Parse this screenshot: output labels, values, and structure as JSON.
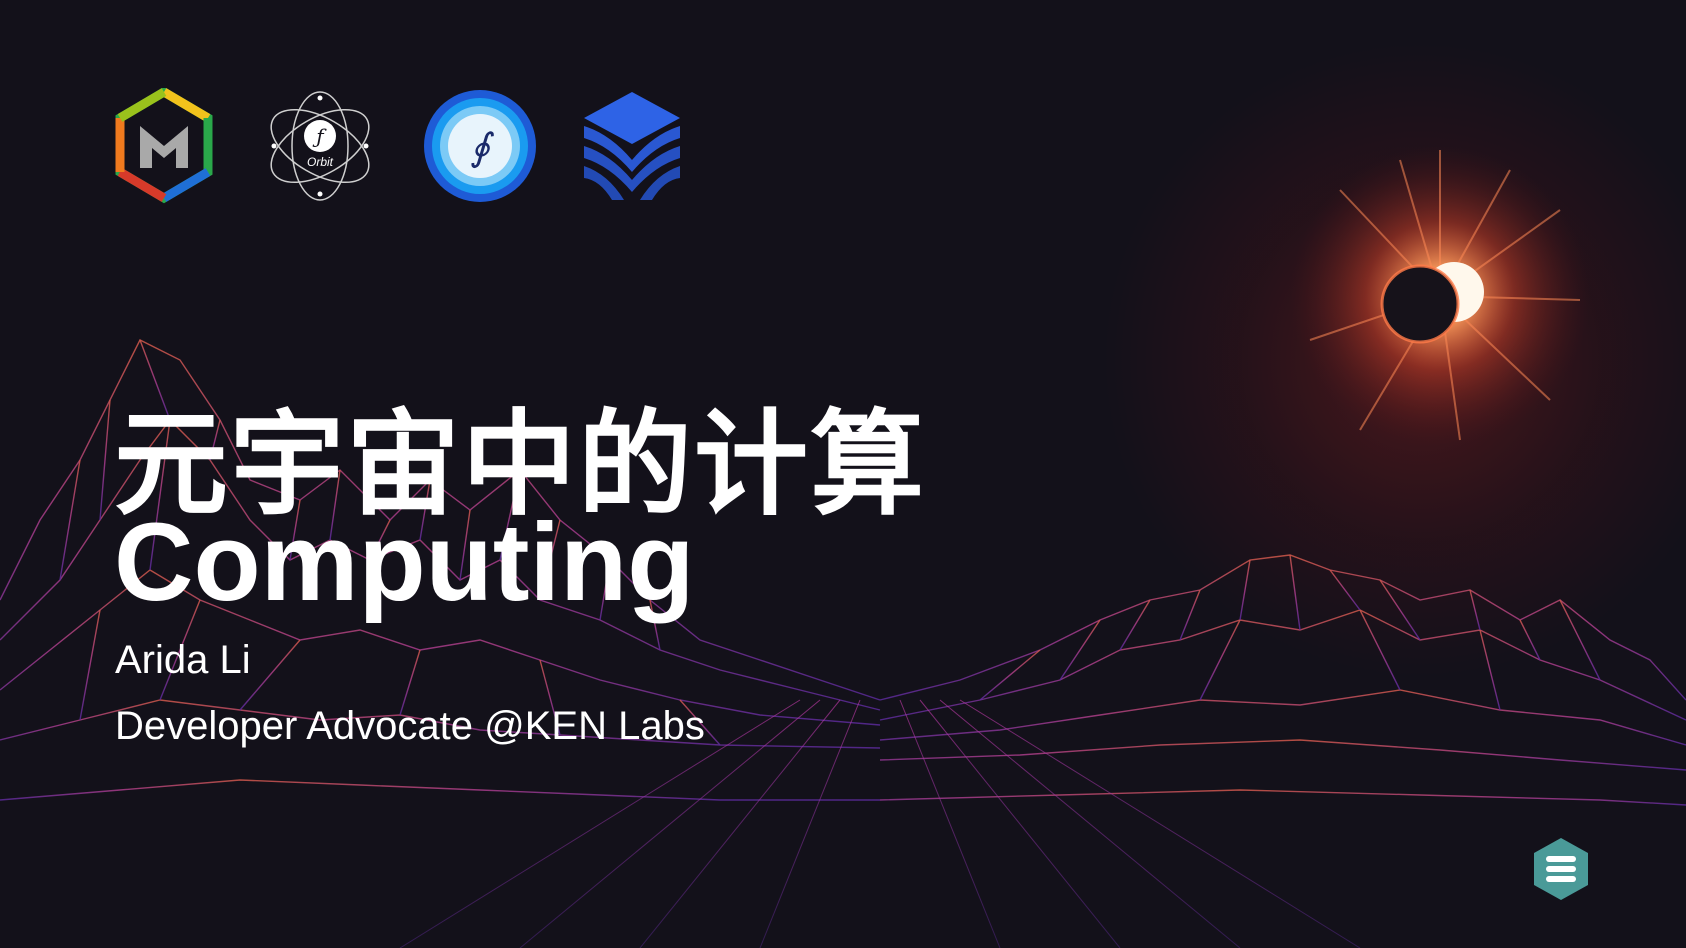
{
  "slide": {
    "title_cn": "元宇宙中的计算",
    "title_en": "Computing",
    "author": "Arida Li",
    "role": "Developer Advocate @KEN Labs"
  },
  "logos": [
    {
      "icon": "hex-m-logo-icon"
    },
    {
      "icon": "orbit-logo-icon",
      "label": "Orbit"
    },
    {
      "icon": "blue-circle-logo-icon"
    },
    {
      "icon": "blue-cube-logo-icon"
    }
  ],
  "corner_badge": {
    "icon": "menu-hexagon-icon"
  },
  "colors": {
    "background": "#13111a",
    "text": "#ffffff",
    "terrain_warm": "#d0584a",
    "terrain_cool": "#8a2fb0",
    "eclipse_glow": "#ff6a3a",
    "badge": "#4a9a98"
  }
}
